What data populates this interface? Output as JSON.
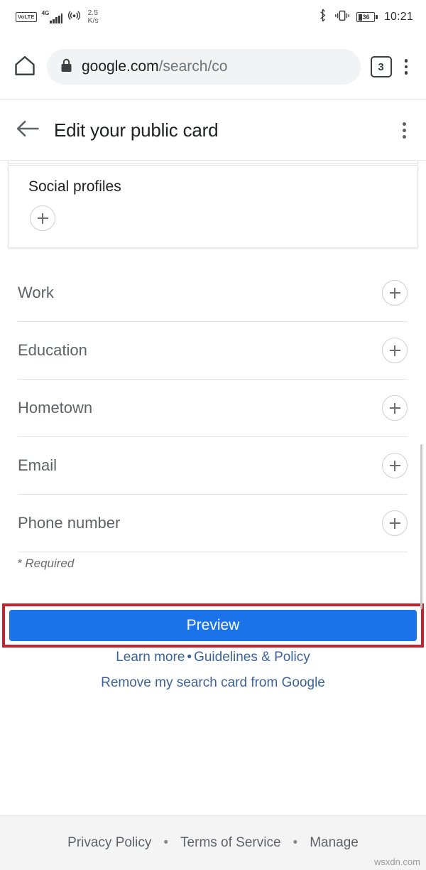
{
  "status_bar": {
    "volte_label": "VoLTE",
    "network_type": "4G",
    "signal_icon": "signal-bars-icon",
    "hotspot_icon": "hotspot-icon",
    "data_speed_value": "2.5",
    "data_speed_unit": "K/s",
    "bluetooth_icon": "bluetooth-icon",
    "vibrate_icon": "vibrate-icon",
    "battery_level": "36",
    "time": "10:21"
  },
  "browser": {
    "home_icon": "home-icon",
    "lock_icon": "lock-icon",
    "url_strong": "google.com",
    "url_dim": "/search/co",
    "tab_count": "3",
    "menu_icon": "overflow-menu-icon"
  },
  "page_header": {
    "back_icon": "back-arrow-icon",
    "title": "Edit your public card",
    "menu_icon": "overflow-menu-icon"
  },
  "social_card": {
    "title": "Social profiles",
    "add_icon": "plus-icon"
  },
  "form_rows": [
    {
      "label": "Work",
      "add_icon": "plus-icon"
    },
    {
      "label": "Education",
      "add_icon": "plus-icon"
    },
    {
      "label": "Hometown",
      "add_icon": "plus-icon"
    },
    {
      "label": "Email",
      "add_icon": "plus-icon"
    },
    {
      "label": "Phone number",
      "add_icon": "plus-icon"
    }
  ],
  "required_note": "* Required",
  "actions": {
    "preview_label": "Preview",
    "preview_color": "#1a73e8",
    "annotation_color": "#c2232c"
  },
  "links": {
    "learn_more": "Learn more",
    "separator": "•",
    "guidelines": "Guidelines & Policy",
    "remove_card": "Remove my search card from Google",
    "link_color": "#3c6398"
  },
  "footer": {
    "privacy": "Privacy Policy",
    "separator": "•",
    "terms": "Terms of Service",
    "manage": "Manage"
  },
  "watermark": "wsxdn.com"
}
